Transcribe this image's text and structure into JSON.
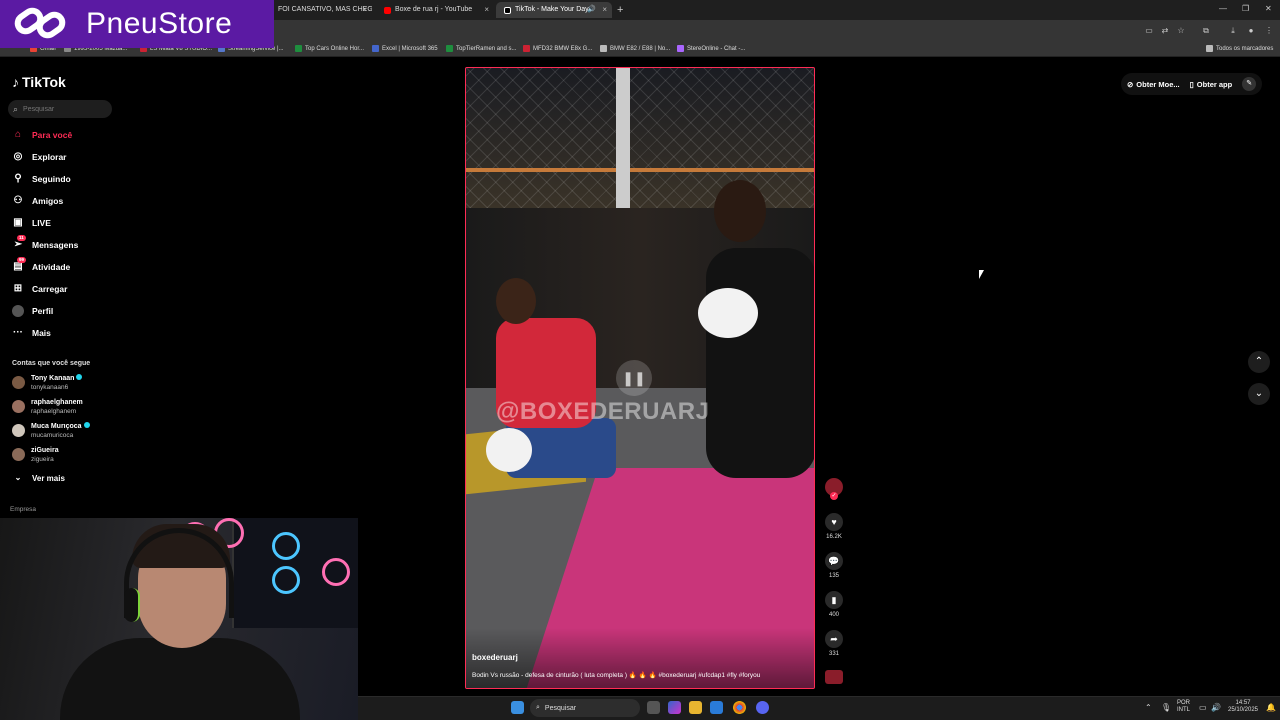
{
  "browser": {
    "tabs": [
      {
        "label": "FOI CANSATIVO, MAS CHEGAM",
        "color": "#cc0000"
      },
      {
        "label": "Boxe de rua rj - YouTube",
        "color": "#ff0000"
      },
      {
        "label": "TikTok - Make Your Day",
        "color": "#ffffff"
      }
    ],
    "new_tab": "+",
    "bookmarks": [
      {
        "label": "Gmail",
        "color": "#ea4335"
      },
      {
        "label": "1995-2005 Mazda...",
        "color": "#888888"
      },
      {
        "label": "LS Miata V8 STUDIO...",
        "color": "#cc2233"
      },
      {
        "label": "StreamingService |...",
        "color": "#5577cc"
      },
      {
        "label": "Top Cars Online Hor...",
        "color": "#1e8e3e"
      },
      {
        "label": "Excel | Microsoft 365",
        "color": "#4466cc"
      },
      {
        "label": "TopTierRamen and s...",
        "color": "#1e8e3e"
      },
      {
        "label": "MFD32 BMW E8x G...",
        "color": "#cc2233"
      },
      {
        "label": "BMW E82 / E88 | No...",
        "color": "#bbbbbb"
      },
      {
        "label": "StereOnline - Chat -...",
        "color": "#aa66ff"
      }
    ],
    "all_bookmarks": "Todos os marcadores"
  },
  "overlay": {
    "brand": "PneuStore",
    "brand_color": "#5b1aa3"
  },
  "sidebar": {
    "logo": "TikTok",
    "search_placeholder": "Pesquisar",
    "nav": [
      {
        "label": "Para você",
        "icon": "home-icon",
        "active": true
      },
      {
        "label": "Explorar",
        "icon": "compass-icon"
      },
      {
        "label": "Seguindo",
        "icon": "user-follow-icon"
      },
      {
        "label": "Amigos",
        "icon": "friends-icon"
      },
      {
        "label": "LIVE",
        "icon": "live-icon"
      },
      {
        "label": "Mensagens",
        "icon": "message-icon",
        "badge": "11"
      },
      {
        "label": "Atividade",
        "icon": "inbox-icon",
        "badge": "99"
      },
      {
        "label": "Carregar",
        "icon": "upload-icon"
      },
      {
        "label": "Perfil",
        "icon": "profile-avatar-icon"
      },
      {
        "label": "Mais",
        "icon": "more-icon"
      }
    ],
    "following_title": "Contas que você segue",
    "following": [
      {
        "name": "Tony Kanaan",
        "handle": "tonykanaan6",
        "verified": true
      },
      {
        "name": "raphaelghanem",
        "handle": "raphaelghanem",
        "verified": false
      },
      {
        "name": "Muca Murıçoca",
        "handle": "mucamuricoca",
        "verified": true
      },
      {
        "name": "ziGueira",
        "handle": "zigueira",
        "verified": false
      }
    ],
    "see_more": "Ver mais",
    "company": "Empresa"
  },
  "top_right": {
    "coins": "Obter Moe...",
    "app": "Obter app"
  },
  "video": {
    "watermark": "@BOXEDERUARJ",
    "author": "boxederuarj",
    "caption": "Bodin Vs russão - defesa de cinturão ( luta completa ) 🔥 🔥 🔥 #boxederuarj #ufcdap1 #fly #foryou",
    "likes": "16.2K",
    "comments": "135",
    "saves": "400",
    "shares": "331"
  },
  "taskbar": {
    "search": "Pesquisar",
    "lang_top": "POR",
    "lang_bottom": "INTL",
    "time": "14:57",
    "date": "25/10/2025"
  }
}
